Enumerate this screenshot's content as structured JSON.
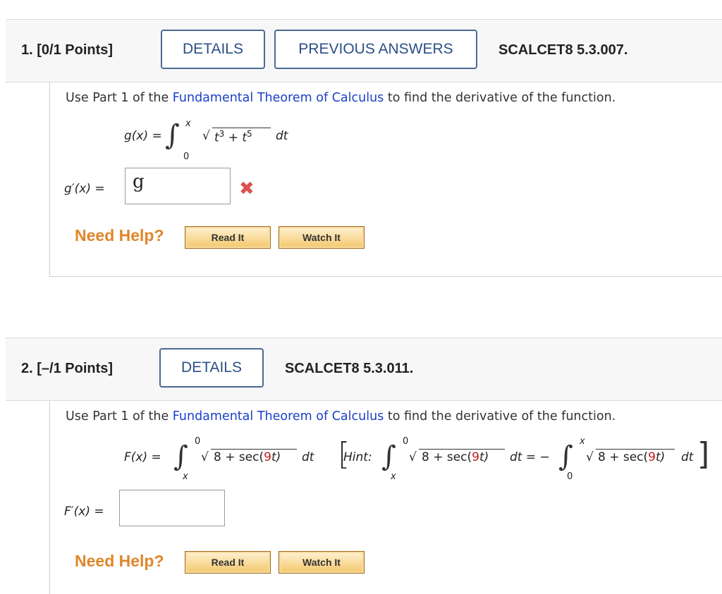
{
  "q1": {
    "points": "1. [0/1 Points]",
    "details_label": "DETAILS",
    "prev_label": "PREVIOUS ANSWERS",
    "code": "SCALCET8 5.3.007.",
    "prompt_pre": "Use Part 1 of the ",
    "prompt_link": "Fundamental Theorem of Calculus",
    "prompt_post": " to find the derivative of the function.",
    "fn_lhs": "g(x) =",
    "upper": "x",
    "lower": "0",
    "radicand": "t3 + t5",
    "dt": "dt",
    "answer_label": "g′(x) =",
    "answer_value": "g",
    "status_icon": "✖",
    "need_help": "Need Help?",
    "read_it": "Read It",
    "watch_it": "Watch It"
  },
  "q2": {
    "points": "2. [–/1 Points]",
    "details_label": "DETAILS",
    "code": "SCALCET8 5.3.011.",
    "prompt_pre": "Use Part 1 of the ",
    "prompt_link": "Fundamental Theorem of Calculus",
    "prompt_post": " to find the derivative of the function.",
    "fn_lhs": "F(x) =",
    "upper": "0",
    "lower": "x",
    "radicand_a": "8 + sec(",
    "radicand_red": "9",
    "radicand_b": "t)",
    "dt": "dt",
    "hint_label": "Hint:",
    "hint_eq": "dt = −",
    "hint_upper2": "x",
    "hint_lower2": "0",
    "answer_label": "F′(x) =",
    "answer_value": "",
    "need_help": "Need Help?",
    "read_it": "Read It",
    "watch_it": "Watch It"
  }
}
